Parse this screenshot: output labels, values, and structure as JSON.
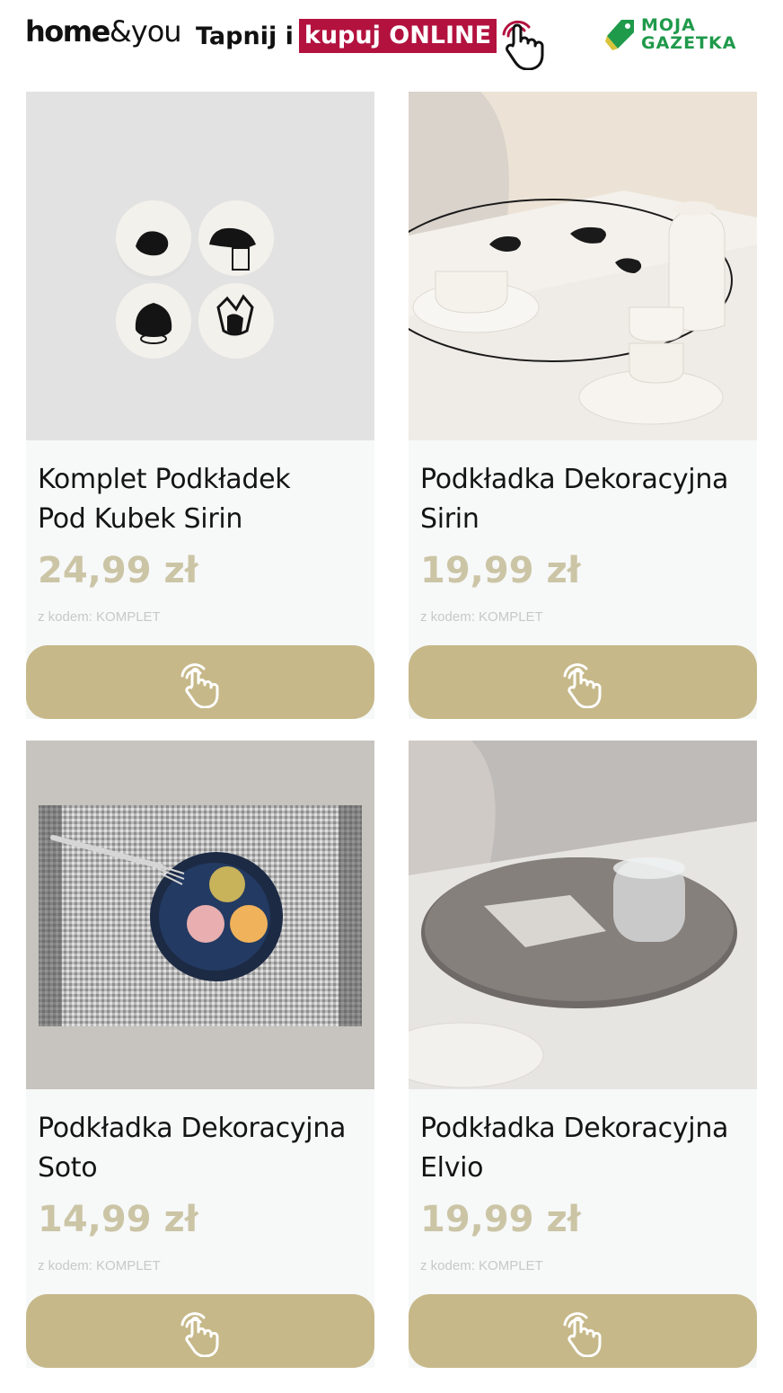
{
  "header": {
    "brand_main": "home",
    "brand_suffix": "&you",
    "cta_prefix": "Tapnij i",
    "cta_highlight": "kupuj ONLINE",
    "partner_line1": "MOJA",
    "partner_line2": "GAZETKA",
    "hand_icon": "tap-hand-icon",
    "partner_icon": "price-tag-icon"
  },
  "colors": {
    "cta_highlight_bg": "#b3123f",
    "price_text": "#cbc5a6",
    "button_bg": "#c6b889",
    "partner_green": "#1f9a4b"
  },
  "products": [
    {
      "title_line1": "Komplet Podkładek",
      "title_line2": "Pod Kubek Sirin",
      "price": "24,99 zł",
      "code": "z kodem: KOMPLET",
      "button_icon": "tap-hand-icon"
    },
    {
      "title_line1": "Podkładka Dekoracyjna",
      "title_line2": "Sirin",
      "price": "19,99 zł",
      "code": "z kodem: KOMPLET",
      "button_icon": "tap-hand-icon"
    },
    {
      "title_line1": "Podkładka Dekoracyjna",
      "title_line2": "Soto",
      "price": "14,99 zł",
      "code": "z kodem: KOMPLET",
      "button_icon": "tap-hand-icon"
    },
    {
      "title_line1": "Podkładka Dekoracyjna",
      "title_line2": "Elvio",
      "price": "19,99 zł",
      "code": "z kodem: KOMPLET",
      "button_icon": "tap-hand-icon"
    }
  ]
}
